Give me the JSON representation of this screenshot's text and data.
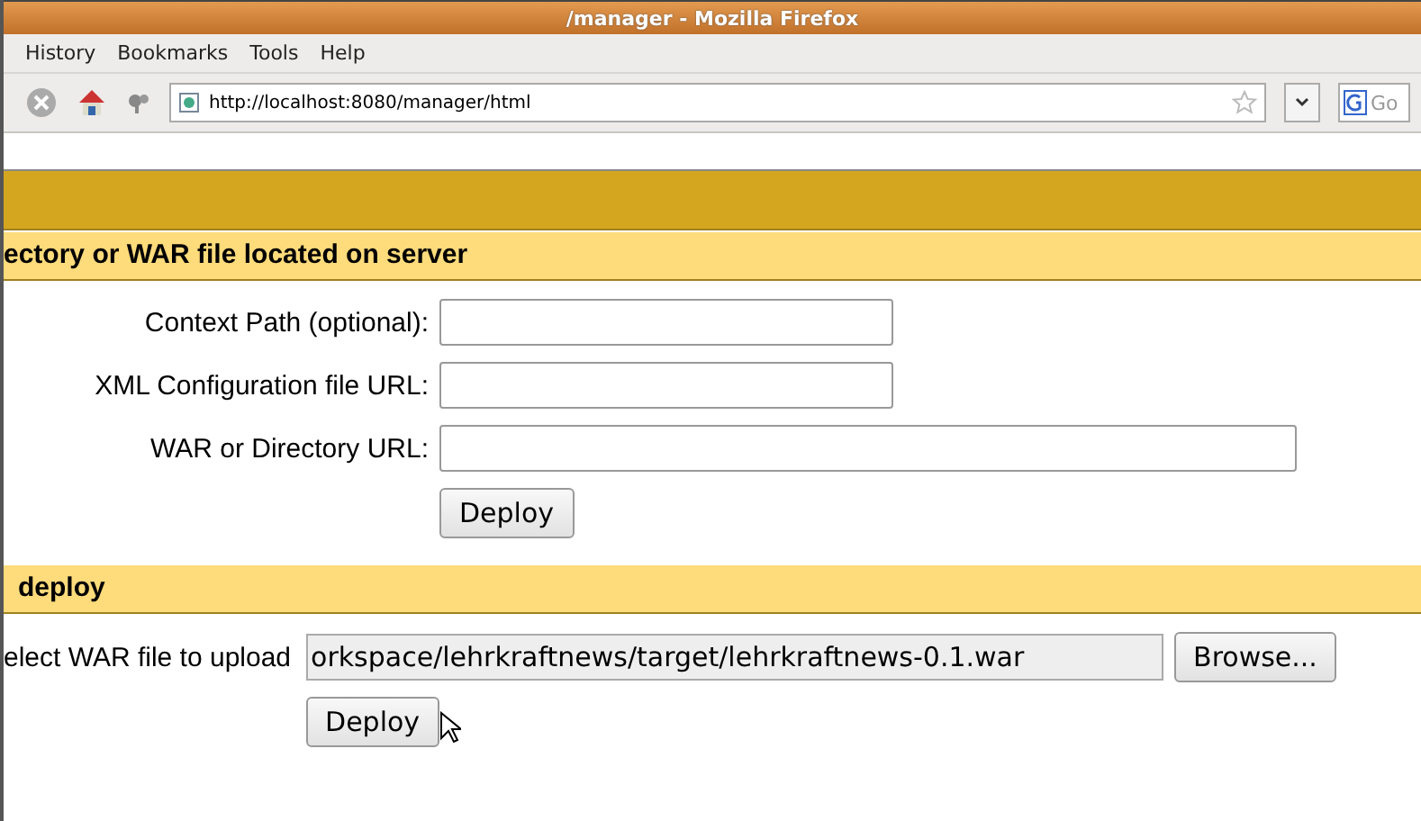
{
  "window": {
    "title": "/manager - Mozilla Firefox"
  },
  "menu": [
    "History",
    "Bookmarks",
    "Tools",
    "Help"
  ],
  "toolbar": {
    "url": "http://localhost:8080/manager/html",
    "search_placeholder": "Go"
  },
  "deploy_server": {
    "heading": "ectory or WAR file located on server",
    "fields": [
      {
        "label": "Context Path (optional):",
        "wide": false
      },
      {
        "label": "XML Configuration file URL:",
        "wide": false
      },
      {
        "label": "WAR or Directory URL:",
        "wide": true
      }
    ],
    "button": "Deploy"
  },
  "deploy_upload": {
    "heading": "deploy",
    "label": "elect WAR file to upload",
    "file": "orkspace/lehrkraftnews/target/lehrkraftnews-0.1.war",
    "browse": "Browse...",
    "button": "Deploy"
  }
}
